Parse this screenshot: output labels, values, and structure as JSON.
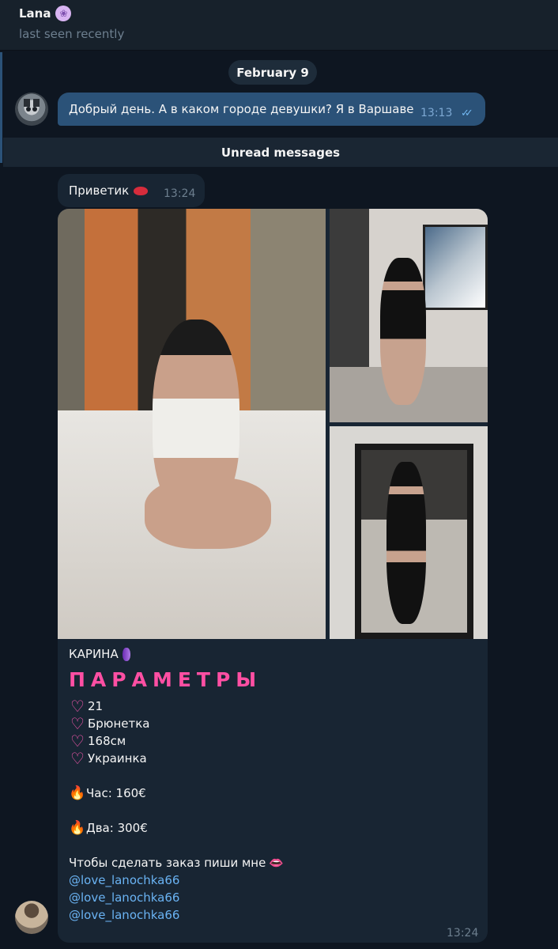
{
  "header": {
    "name": "Lana",
    "emoji_icon": "paw-emoji-icon",
    "status": "last seen recently"
  },
  "date_separator": "February 9",
  "outgoing_message": {
    "text": "Добрый день. А в каком городе девушки? Я в Варшаве",
    "time": "13:13",
    "read_ticks": "✓✓"
  },
  "unread_divider": "Unread messages",
  "incoming_greeting": {
    "text": "Приветик",
    "emoji_icon": "lips-emoji-icon",
    "time": "13:24"
  },
  "album": {
    "photos": [
      "photo-1",
      "photo-2",
      "photo-3"
    ],
    "caption": {
      "name": "КАРИНА",
      "params_title": "ПАРАМЕТРЫ",
      "heart": "♡",
      "fire": "🔥",
      "age": "21",
      "hair": "Брюнетка",
      "height": " 168см",
      "nationality": "Украинка",
      "hour_price": "Час: 160€",
      "two_hours_price": "Два: 300€",
      "order_text": "Чтобы сделать заказ пиши мне",
      "mouth": "👄",
      "links": [
        "@love_lanochka66",
        "@love_lanochka66",
        "@love_lanochka66"
      ]
    },
    "time": "13:24"
  },
  "colors": {
    "background": "#0e1621",
    "incoming_bubble": "#182533",
    "outgoing_bubble": "#2b5278",
    "link": "#6ab3f3",
    "params_pink": "#ff4fa3"
  }
}
